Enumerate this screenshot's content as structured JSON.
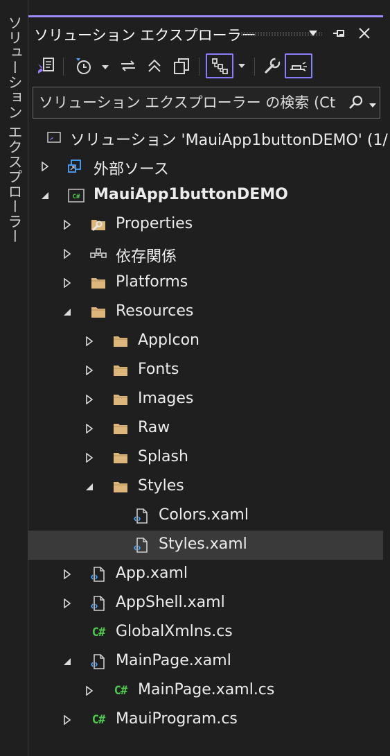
{
  "side_tab": {
    "label": "ソリューション エクスプローラー"
  },
  "panel": {
    "title": "ソリューション エクスプローラー",
    "accent_color": "#9d8cff"
  },
  "toolbar": {
    "buttons": [
      {
        "icon": "switch-views-icon"
      },
      {
        "icon": "pending-changes-filter-icon"
      },
      {
        "icon": "sync-with-document-icon"
      },
      {
        "icon": "collapse-all-icon"
      },
      {
        "icon": "show-all-files-icon"
      },
      {
        "icon": "view-class-diagram-icon",
        "active": true
      },
      {
        "icon": "properties-wrench-icon"
      },
      {
        "icon": "preview-selected-items-icon",
        "active": true
      }
    ]
  },
  "search": {
    "placeholder": "ソリューション エクスプローラー の検索 (Ctrl+"
  },
  "tree": [
    {
      "label": "ソリューション 'MauiApp1buttonDEMO' (1/",
      "icon": "solution-icon"
    },
    {
      "label": "外部ソース",
      "icon": "external-sources-icon"
    },
    {
      "label": "MauiApp1buttonDEMO",
      "icon": "csharp-project-icon",
      "bold": true
    },
    {
      "label": "Properties",
      "icon": "properties-folder-icon"
    },
    {
      "label": "依存関係",
      "icon": "dependencies-icon"
    },
    {
      "label": "Platforms",
      "icon": "folder-icon"
    },
    {
      "label": "Resources",
      "icon": "folder-icon"
    },
    {
      "label": "AppIcon",
      "icon": "folder-icon"
    },
    {
      "label": "Fonts",
      "icon": "folder-icon"
    },
    {
      "label": "Images",
      "icon": "folder-icon"
    },
    {
      "label": "Raw",
      "icon": "folder-icon"
    },
    {
      "label": "Splash",
      "icon": "folder-icon"
    },
    {
      "label": "Styles",
      "icon": "folder-icon"
    },
    {
      "label": "Colors.xaml",
      "icon": "xaml-file-icon"
    },
    {
      "label": "Styles.xaml",
      "icon": "xaml-file-icon",
      "selected": true
    },
    {
      "label": "App.xaml",
      "icon": "xaml-file-icon"
    },
    {
      "label": "AppShell.xaml",
      "icon": "xaml-file-icon"
    },
    {
      "label": "GlobalXmlns.cs",
      "icon": "csharp-file-icon"
    },
    {
      "label": "MainPage.xaml",
      "icon": "xaml-file-icon"
    },
    {
      "label": "MainPage.xaml.cs",
      "icon": "csharp-file-icon"
    },
    {
      "label": "MauiProgram.cs",
      "icon": "csharp-file-icon"
    }
  ]
}
